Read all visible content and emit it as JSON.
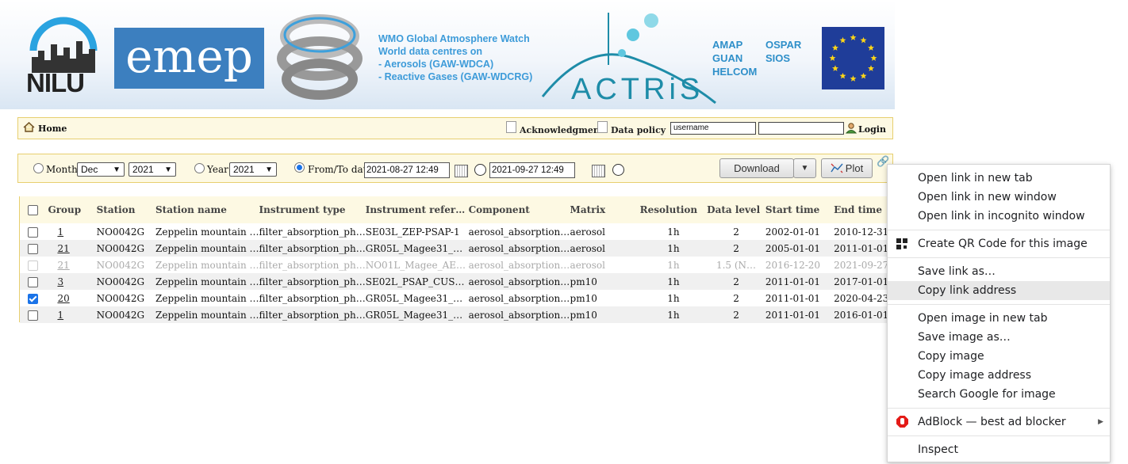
{
  "banner": {
    "nilu_logo": "NILU",
    "emep_logo": "emep",
    "wmo_lines": [
      "WMO Global Atmosphere Watch",
      "World data centres on",
      "- Aerosols (GAW-WDCA)",
      "- Reactive Gases (GAW-WDCRG)"
    ],
    "actris_logo": "ACTRiS",
    "orgs_col1": [
      "AMAP",
      "GUAN",
      "HELCOM"
    ],
    "orgs_col2": [
      "OSPAR",
      "SIOS"
    ]
  },
  "topnav": {
    "home": "Home",
    "acknowledgment": "Acknowledgment",
    "data_policy": "Data policy",
    "username_value": "username",
    "password_value": "",
    "login": "Login"
  },
  "datebar": {
    "month_label": "Month",
    "month_value": "Dec",
    "month_year_value": "2021",
    "year_label": "Year",
    "year_value": "2021",
    "fromto_label": "From/To date",
    "from_date": "2021-08-27 12:49",
    "to_date": "2021-09-27 12:49",
    "selected_mode": "from_to",
    "download_label": "Download",
    "plot_label": "Plot"
  },
  "table": {
    "headers": [
      "Group",
      "Station",
      "Station name",
      "Instrument type",
      "Instrument refer…",
      "Component",
      "Matrix",
      "Resolution",
      "Data level",
      "Start time",
      "End time"
    ],
    "rows": [
      {
        "checked": false,
        "disabled": false,
        "group": "1",
        "station": "NO0042G",
        "station_name": "Zeppelin mountain …",
        "instrument_type": "filter_absorption_ph…",
        "instrument_ref": "SE03L_ZEP-PSAP-1",
        "component": "aerosol_absorption…",
        "matrix": "aerosol",
        "resolution": "1h",
        "data_level": "2",
        "start": "2002-01-01",
        "end": "2010-12-31"
      },
      {
        "checked": false,
        "disabled": false,
        "group": "21",
        "station": "NO0042G",
        "station_name": "Zeppelin mountain …",
        "instrument_type": "filter_absorption_ph…",
        "instrument_ref": "GR05L_Magee31_…",
        "component": "aerosol_absorption…",
        "matrix": "aerosol",
        "resolution": "1h",
        "data_level": "2",
        "start": "2005-01-01",
        "end": "2011-01-01"
      },
      {
        "checked": false,
        "disabled": true,
        "group": "21",
        "station": "NO0042G",
        "station_name": "Zeppelin mountain …",
        "instrument_type": "filter_absorption_ph…",
        "instrument_ref": "NO01L_Magee_AE…",
        "component": "aerosol_absorption…",
        "matrix": "aerosol",
        "resolution": "1h",
        "data_level": "1.5 (N…",
        "start": "2016-12-20",
        "end": "2021-09-27"
      },
      {
        "checked": false,
        "disabled": false,
        "group": "3",
        "station": "NO0042G",
        "station_name": "Zeppelin mountain …",
        "instrument_type": "filter_absorption_ph…",
        "instrument_ref": "SE02L_PSAP_CUS…",
        "component": "aerosol_absorption…",
        "matrix": "pm10",
        "resolution": "1h",
        "data_level": "2",
        "start": "2011-01-01",
        "end": "2017-01-01"
      },
      {
        "checked": true,
        "disabled": false,
        "group": "20",
        "station": "NO0042G",
        "station_name": "Zeppelin mountain …",
        "instrument_type": "filter_absorption_ph…",
        "instrument_ref": "GR05L_Magee31_…",
        "component": "aerosol_absorption…",
        "matrix": "pm10",
        "resolution": "1h",
        "data_level": "2",
        "start": "2011-01-01",
        "end": "2020-04-23"
      },
      {
        "checked": false,
        "disabled": false,
        "group": "1",
        "station": "NO0042G",
        "station_name": "Zeppelin mountain …",
        "instrument_type": "filter_absorption_ph…",
        "instrument_ref": "GR05L_Magee31_…",
        "component": "aerosol_absorption…",
        "matrix": "pm10",
        "resolution": "1h",
        "data_level": "2",
        "start": "2011-01-01",
        "end": "2016-01-01"
      }
    ]
  },
  "context_menu": {
    "groups": [
      [
        {
          "label": "Open link in new tab"
        },
        {
          "label": "Open link in new window"
        },
        {
          "label": "Open link in incognito window"
        }
      ],
      [
        {
          "label": "Create QR Code for this image",
          "icon": "qr-code-icon"
        }
      ],
      [
        {
          "label": "Save link as…"
        },
        {
          "label": "Copy link address",
          "highlighted": true
        }
      ],
      [
        {
          "label": "Open image in new tab"
        },
        {
          "label": "Save image as…"
        },
        {
          "label": "Copy image"
        },
        {
          "label": "Copy image address"
        },
        {
          "label": "Search Google for image"
        }
      ],
      [
        {
          "label": "AdBlock — best ad blocker",
          "icon": "adblock-icon",
          "submenu": true
        }
      ],
      [
        {
          "label": "Inspect"
        }
      ]
    ]
  }
}
